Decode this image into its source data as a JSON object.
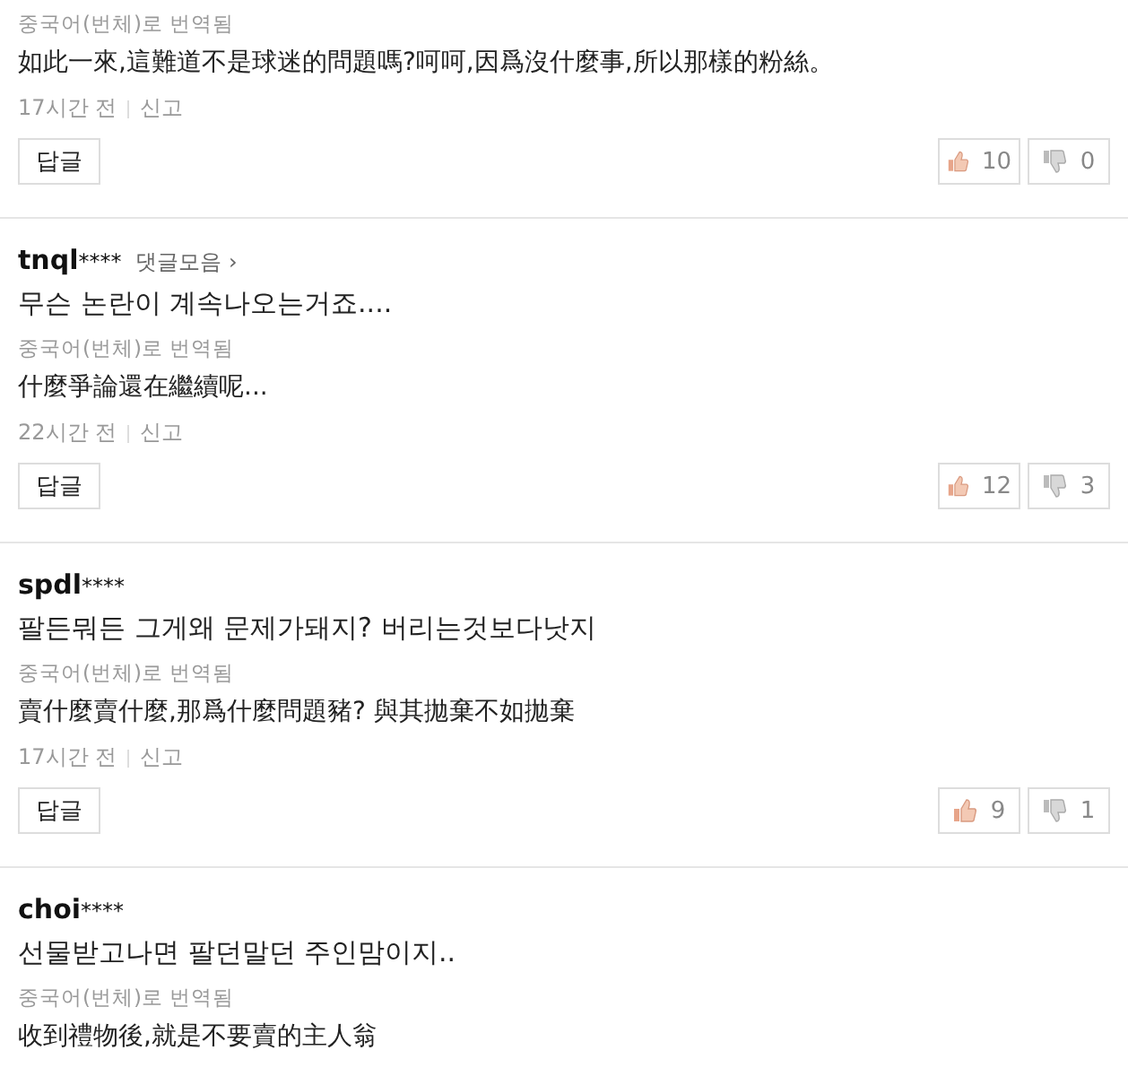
{
  "comments": [
    {
      "translation_label": "중국어(번체)로 번역됨",
      "translation": "如此一來,這難道不是球迷的問題嗎?呵呵,因爲沒什麼事,所以那樣的粉絲。",
      "time": "17시간 전",
      "report": "신고",
      "reply": "답글",
      "likes": "10",
      "dislikes": "0"
    },
    {
      "author": "tnql",
      "masked": "****",
      "collection_link": "댓글모음 ›",
      "text": "무슨 논란이 계속나오는거죠....",
      "translation_label": "중국어(번체)로 번역됨",
      "translation": "什麼爭論還在繼續呢...",
      "time": "22시간 전",
      "report": "신고",
      "reply": "답글",
      "likes": "12",
      "dislikes": "3"
    },
    {
      "author": "spdl",
      "masked": "****",
      "text": "팔든뭐든 그게왜 문제가돼지? 버리는것보다낫지",
      "translation_label": "중국어(번체)로 번역됨",
      "translation": "賣什麼賣什麼,那爲什麼問題豬? 與其拋棄不如拋棄",
      "time": "17시간 전",
      "report": "신고",
      "reply": "답글",
      "likes": "9",
      "dislikes": "1"
    },
    {
      "author": "choi",
      "masked": "****",
      "text": "선물받고나면 팔던말던 주인맘이지..",
      "translation_label": "중국어(번체)로 번역됨",
      "translation": "收到禮物後,就是不要賣的主人翁"
    }
  ]
}
